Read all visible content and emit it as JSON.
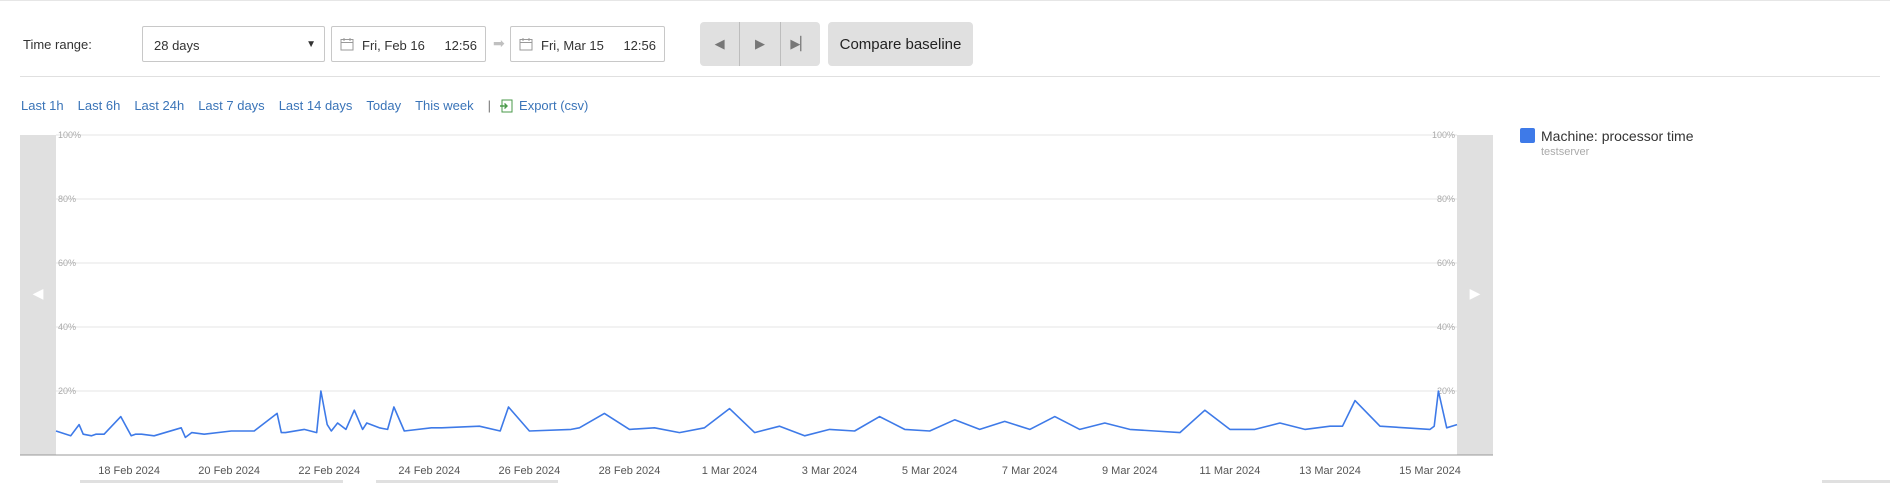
{
  "toolbar": {
    "time_range_label": "Time range:",
    "range_select": {
      "value": "28 days"
    },
    "start": {
      "date": "Fri, Feb 16",
      "time": "12:56"
    },
    "end": {
      "date": "Fri, Mar 15",
      "time": "12:56"
    },
    "compare_label": "Compare baseline"
  },
  "quick_links": [
    "Last 1h",
    "Last 6h",
    "Last 24h",
    "Last 7 days",
    "Last 14 days",
    "Today",
    "This week"
  ],
  "export_label": "Export (csv)",
  "legend": {
    "name": "Machine: processor time",
    "source": "testserver"
  },
  "colors": {
    "series": "#3e7ae8",
    "link": "#3a74b8",
    "pane": "#e0e0e0"
  },
  "chart_data": {
    "type": "line",
    "ylim": [
      0,
      100
    ],
    "y_ticks": [
      0,
      20,
      40,
      60,
      80,
      100
    ],
    "y_tick_labels": [
      "",
      "20%",
      "40%",
      "60%",
      "80%",
      "100%"
    ],
    "x_range": [
      "2024-02-16 12:56",
      "2024-03-15 12:56"
    ],
    "x_tick_labels": [
      "18 Feb 2024",
      "20 Feb 2024",
      "22 Feb 2024",
      "24 Feb 2024",
      "26 Feb 2024",
      "28 Feb 2024",
      "1 Mar 2024",
      "3 Mar 2024",
      "5 Mar 2024",
      "7 Mar 2024",
      "9 Mar 2024",
      "11 Mar 2024",
      "13 Mar 2024",
      "15 Mar 2024"
    ],
    "grid": true,
    "legend_position": "right",
    "series": [
      {
        "name": "Machine: processor time",
        "x": [
          "2024-02-16 12:56",
          "2024-02-16 20:00",
          "2024-02-17 00:00",
          "2024-02-17 02:00",
          "2024-02-17 06:00",
          "2024-02-17 08:00",
          "2024-02-17 12:00",
          "2024-02-17 20:00",
          "2024-02-18 01:00",
          "2024-02-18 03:00",
          "2024-02-18 06:00",
          "2024-02-18 12:00",
          "2024-02-19 01:00",
          "2024-02-19 03:00",
          "2024-02-19 06:00",
          "2024-02-19 12:00",
          "2024-02-20 01:00",
          "2024-02-20 12:00",
          "2024-02-20 23:00",
          "2024-02-21 01:00",
          "2024-02-21 03:00",
          "2024-02-21 12:00",
          "2024-02-21 18:00",
          "2024-02-21 20:00",
          "2024-02-21 23:00",
          "2024-02-22 01:00",
          "2024-02-22 04:00",
          "2024-02-22 08:00",
          "2024-02-22 12:00",
          "2024-02-22 16:00",
          "2024-02-22 18:00",
          "2024-02-23 00:00",
          "2024-02-23 04:00",
          "2024-02-23 07:00",
          "2024-02-23 12:00",
          "2024-02-24 01:00",
          "2024-02-24 06:00",
          "2024-02-25 00:00",
          "2024-02-25 10:00",
          "2024-02-25 14:00",
          "2024-02-26 00:00",
          "2024-02-26 20:00",
          "2024-02-27 00:00",
          "2024-02-27 12:00",
          "2024-02-28 00:00",
          "2024-02-28 12:00",
          "2024-02-29 00:00",
          "2024-02-29 12:00",
          "2024-03-01 00:00",
          "2024-03-01 12:00",
          "2024-03-02 00:00",
          "2024-03-02 12:00",
          "2024-03-03 00:00",
          "2024-03-03 12:00",
          "2024-03-04 00:00",
          "2024-03-04 12:00",
          "2024-03-05 00:00",
          "2024-03-05 12:00",
          "2024-03-06 00:00",
          "2024-03-06 12:00",
          "2024-03-07 00:00",
          "2024-03-07 12:00",
          "2024-03-08 00:00",
          "2024-03-08 12:00",
          "2024-03-09 00:00",
          "2024-03-09 12:00",
          "2024-03-10 00:00",
          "2024-03-10 12:00",
          "2024-03-11 00:00",
          "2024-03-11 12:00",
          "2024-03-12 00:00",
          "2024-03-12 12:00",
          "2024-03-13 00:00",
          "2024-03-13 06:00",
          "2024-03-13 12:00",
          "2024-03-14 00:00",
          "2024-03-14 12:00",
          "2024-03-15 00:00",
          "2024-03-15 02:00",
          "2024-03-15 04:00",
          "2024-03-15 08:00",
          "2024-03-15 12:56"
        ],
        "y": [
          7.5,
          6,
          9.5,
          6.5,
          6,
          6.5,
          6.5,
          12,
          6,
          6.5,
          6.5,
          6,
          8.5,
          5.5,
          7,
          6.5,
          7.5,
          7.5,
          13,
          7,
          7,
          8,
          7,
          20,
          9.5,
          7.5,
          10,
          8,
          14,
          8,
          10,
          8.5,
          8,
          15,
          7.5,
          8.5,
          8.5,
          9,
          7.5,
          15,
          7.5,
          8,
          8.5,
          13,
          8,
          8.5,
          7,
          8.5,
          14.5,
          7,
          9,
          6,
          8,
          7.5,
          12,
          8,
          7.5,
          11,
          8,
          10.5,
          8,
          12,
          8,
          10,
          8,
          7.5,
          7,
          14,
          8,
          8,
          10,
          8,
          9,
          9,
          17,
          9,
          8.5,
          8,
          9,
          20,
          8.5,
          9.5
        ]
      }
    ]
  }
}
